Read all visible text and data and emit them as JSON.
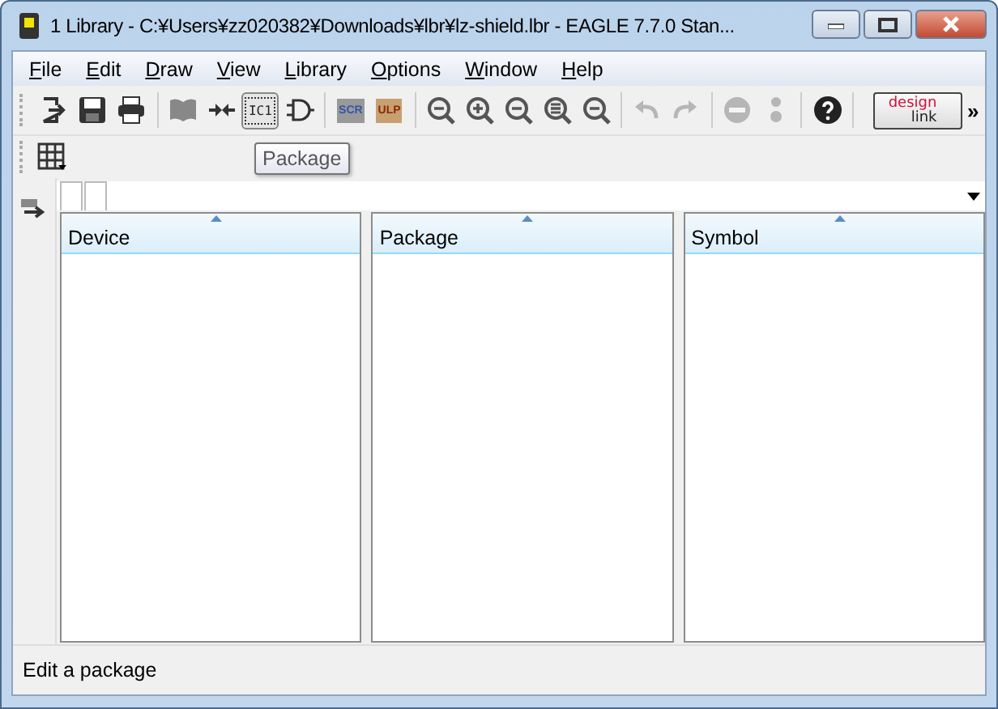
{
  "window": {
    "title": "1 Library - C:¥Users¥zz020382¥Downloads¥lbr¥lz-shield.lbr - EAGLE 7.7.0 Stan..."
  },
  "menu": [
    "File",
    "Edit",
    "Draw",
    "View",
    "Library",
    "Options",
    "Window",
    "Help"
  ],
  "toolbar": {
    "groups": [
      [
        {
          "disabled": false
        },
        {
          "disabled": false
        },
        {
          "disabled": false
        }
      ],
      [
        {
          "disabled": false
        },
        {
          "disabled": false
        },
        {
          "label": "IC1",
          "disabled": false,
          "selected": true
        },
        {
          "disabled": false
        }
      ],
      [
        {
          "label": "SCR",
          "disabled": false
        },
        {
          "label": "ULP",
          "disabled": false
        }
      ],
      [
        {
          "disabled": false
        },
        {
          "disabled": false
        },
        {
          "disabled": false
        },
        {
          "disabled": false
        },
        {
          "disabled": false
        }
      ],
      [
        {
          "disabled": true
        },
        {
          "disabled": true
        }
      ],
      [
        {
          "disabled": true
        },
        {
          "disabled": true
        }
      ],
      [
        {
          "disabled": false
        }
      ]
    ],
    "logo_words": [
      "design",
      "link"
    ],
    "overflow": "»"
  },
  "tooltip": "Package",
  "columns": [
    {
      "header": "Device"
    },
    {
      "header": "Package"
    },
    {
      "header": "Symbol"
    }
  ],
  "status_bar": "Edit a package"
}
